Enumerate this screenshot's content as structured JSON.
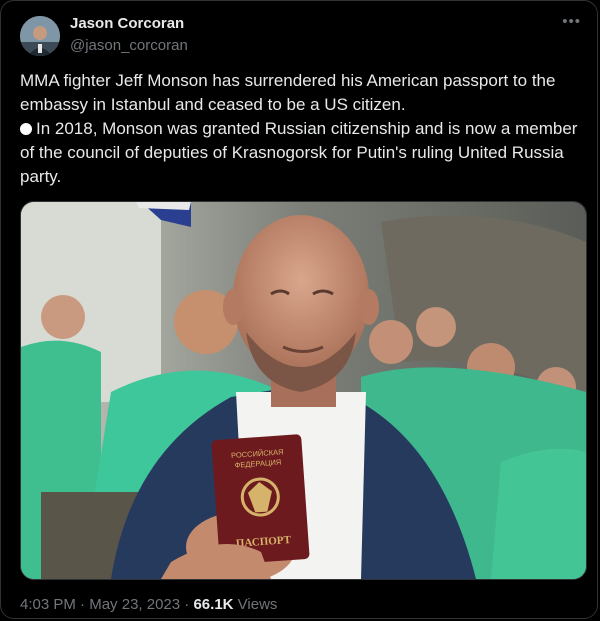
{
  "author": {
    "name": "Jason Corcoran",
    "handle": "@jason_corcoran"
  },
  "menu_icon": "more-horizontal-icon",
  "tweet": {
    "paragraph1": "MMA fighter Jeff Monson has surrendered his American passport to the embassy in Istanbul and ceased to be a US citizen.",
    "paragraph2": "In 2018, Monson was granted Russian citizenship and is now a member of the council of deputies of Krasnogorsk for Putin's ruling United Russia party."
  },
  "photo": {
    "passport_line1": "РОССИЙСКАЯ",
    "passport_line2": "ФЕДЕРАЦИЯ",
    "passport_title": "ПАСПОРТ"
  },
  "meta": {
    "time": "4:03 PM",
    "date": "May 23, 2023",
    "views_count": "66.1K",
    "views_label": "Views"
  }
}
